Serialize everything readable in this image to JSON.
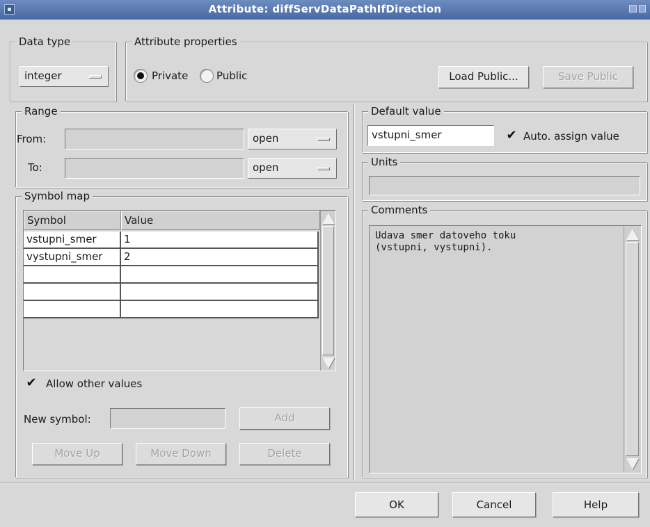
{
  "window": {
    "title": "Attribute: diffServDataPathIfDirection"
  },
  "data_type": {
    "legend": "Data type",
    "selected": "integer"
  },
  "attribute_properties": {
    "legend": "Attribute properties",
    "private_label": "Private",
    "public_label": "Public",
    "selected": "Private",
    "load_public": "Load Public...",
    "save_public": "Save Public"
  },
  "range": {
    "legend": "Range",
    "from_label": "From:",
    "to_label": "To:",
    "from_value": "",
    "to_value": "",
    "from_bound": "open",
    "to_bound": "open"
  },
  "symbol_map": {
    "legend": "Symbol map",
    "columns": [
      "Symbol",
      "Value"
    ],
    "rows": [
      [
        "vstupni_smer",
        "1"
      ],
      [
        "vystupni_smer",
        "2"
      ],
      [
        "",
        ""
      ],
      [
        "",
        ""
      ],
      [
        "",
        ""
      ]
    ],
    "allow_other_values": "Allow other values",
    "allow_other_checked": true,
    "new_symbol_label": "New symbol:",
    "new_symbol_value": "",
    "add": "Add",
    "move_up": "Move Up",
    "move_down": "Move Down",
    "delete": "Delete"
  },
  "default_value": {
    "legend": "Default value",
    "value": "vstupni_smer",
    "auto_assign_label": "Auto. assign value",
    "auto_assign_checked": true
  },
  "units": {
    "legend": "Units",
    "value": ""
  },
  "comments": {
    "legend": "Comments",
    "text": "Udava smer datoveho toku\n(vstupni, vystupni)."
  },
  "footer": {
    "ok": "OK",
    "cancel": "Cancel",
    "help": "Help"
  },
  "colors": {
    "titlebar": "#4a6aa3",
    "dialog_bg": "#d8d8d8"
  }
}
